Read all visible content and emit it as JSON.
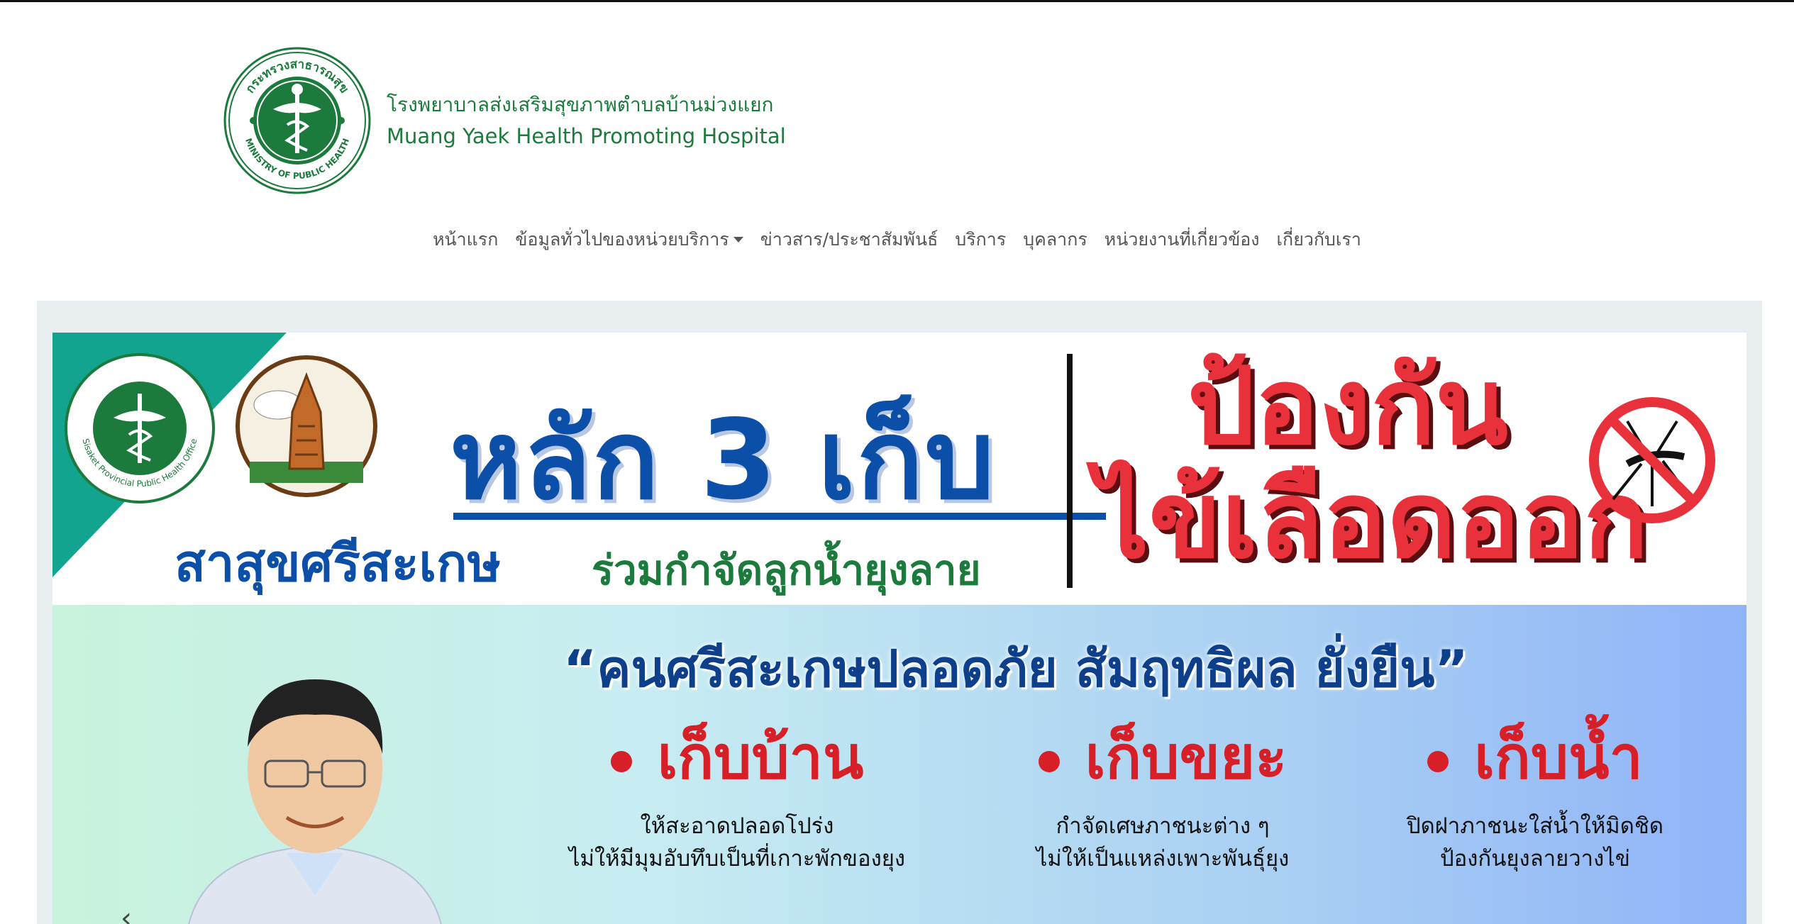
{
  "brand": {
    "name_th": "โรงพยาบาลส่งเสริมสุขภาพตำบลบ้านม่วงแยก",
    "name_en": "Muang Yaek Health Promoting Hospital",
    "logo_icon": "ministry-of-public-health-logo-icon",
    "logo_text_top": "กระทรวงสาธารณสุข",
    "logo_text_bottom": "MINISTRY OF PUBLIC HEALTH"
  },
  "nav": {
    "items": [
      {
        "label": "หน้าแรก"
      },
      {
        "label": "ข้อมูลทั่วไปของหน่วยบริการ",
        "dropdown": true
      },
      {
        "label": "ข่าวสาร/ประชาสัมพันธ์"
      },
      {
        "label": "บริการ"
      },
      {
        "label": "บุคลากร"
      },
      {
        "label": "หน่วยงานที่เกี่ยวข้อง"
      },
      {
        "label": "เกี่ยวกับเรา"
      }
    ]
  },
  "banner": {
    "headline": "หลัก 3 เก็บ",
    "subline_blue": "สาสุขศรีสะเกษ",
    "subline_green": "ร่วมกำจัดลูกน้ำยุงลาย",
    "prevent_line1": "ป้องกัน",
    "prevent_line2": "ไข้เลือดออก",
    "seal_left_text": "Sisaket Provincial Public Health Office",
    "slogan": "“คนศรีสะเกษปลอดภัย สัมฤทธิผล ยั่งยืน”",
    "columns": [
      {
        "title": "เก็บบ้าน",
        "desc1": "ให้สะอาดปลอดโปร่ง",
        "desc2": "ไม่ให้มีมุมอับทึบเป็นที่เกาะพักของยุง"
      },
      {
        "title": "เก็บขยะ",
        "desc1": "กำจัดเศษภาชนะต่าง ๆ",
        "desc2": "ไม่ให้เป็นแหล่งเพาะพันธุ์ยุง"
      },
      {
        "title": "เก็บน้ำ",
        "desc1": "ปิดฝาภาชนะใส่น้ำให้มิดชิด",
        "desc2": "ป้องกันยุงลายวางไข่"
      }
    ]
  },
  "carousel": {
    "prev_symbol": "‹"
  },
  "colors": {
    "brand_green": "#1b7a3c",
    "headline_blue": "#0b4fa8",
    "alert_red": "#e8313b",
    "panel_bg": "#e9eef0"
  }
}
